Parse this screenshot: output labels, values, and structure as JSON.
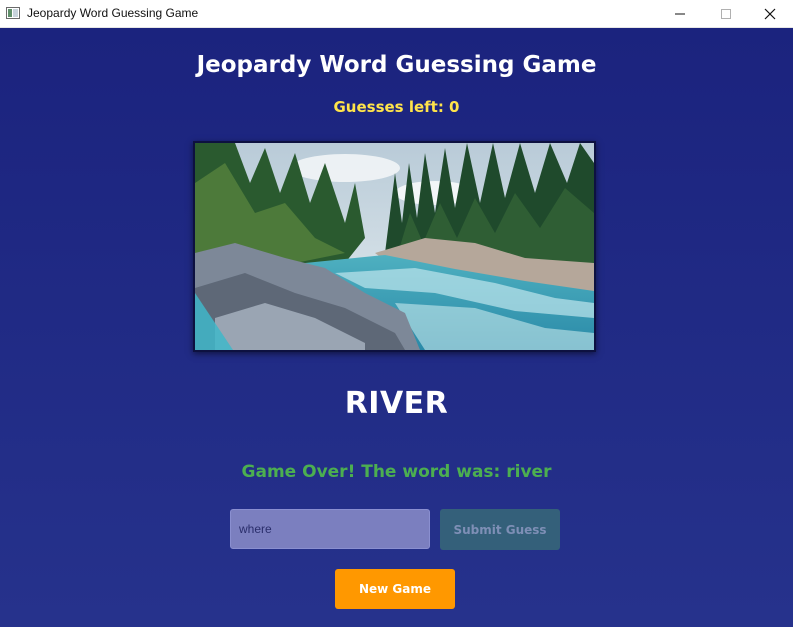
{
  "window": {
    "title": "Jeopardy Word Guessing Game",
    "controls": [
      "minimize-icon",
      "maximize-icon",
      "close-icon"
    ]
  },
  "game": {
    "title": "Jeopardy Word Guessing Game",
    "guesses_left": "Guesses left: 0",
    "image_icon": "river-landscape-image",
    "revealed_word": "RIVER",
    "status": "Game Over! The word was: river"
  },
  "guess": {
    "value": "where",
    "placeholder": "",
    "submit_label": "Submit Guess"
  },
  "controls": {
    "new_game_label": "New Game"
  },
  "colors": {
    "background": "#1b237e",
    "title_text": "#ffffff",
    "guesses_text": "#ffe44a",
    "status_text": "#4caf50",
    "input_background": "#7b7fbf",
    "submit_button": "#34607a",
    "new_game_button": "#ff9800"
  }
}
